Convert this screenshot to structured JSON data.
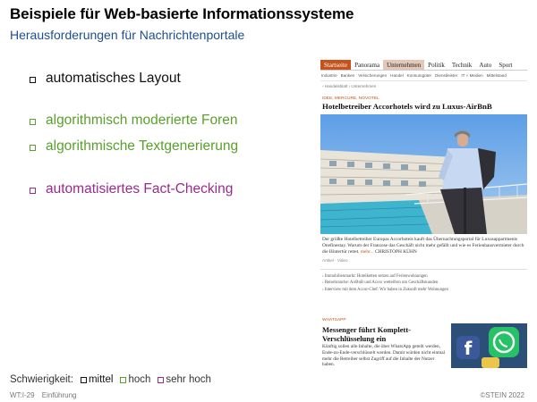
{
  "slide": {
    "title": "Beispiele für Web-basierte Informationssysteme",
    "subtitle": "Herausforderungen für Nachrichtenportale"
  },
  "bullets": [
    {
      "text": "automatisches Layout",
      "color": "#111111"
    },
    {
      "text": "algorithmisch moderierte Foren",
      "color": "#5aa02c"
    },
    {
      "text": "algorithmische Textgenerierung",
      "color": "#5aa02c"
    },
    {
      "text": "automatisiertes Fact-Checking",
      "color": "#9a2a8c"
    }
  ],
  "difficulty": {
    "label": "Schwierigkeit:",
    "options": [
      {
        "text": "mittel",
        "color": "#111111"
      },
      {
        "text": "hoch",
        "color": "#5aa02c"
      },
      {
        "text": "sehr hoch",
        "color": "#9a2a8c"
      }
    ]
  },
  "footer": {
    "slide_number": "WT:I-29",
    "section": "Einführung",
    "copyright": "©STEIN 2022"
  },
  "newspaper": {
    "nav": [
      "Startseite",
      "Panorama",
      "Unternehmen",
      "Politik",
      "Technik",
      "Auto",
      "Sport"
    ],
    "nav_active": "Startseite",
    "nav_selected": "Unternehmen",
    "subnav": [
      "Industrie",
      "Banken",
      "Versicherungen",
      "Handel",
      "Konsumgüter",
      "Dienstleister",
      "IT + Medien",
      "Mittelstand"
    ],
    "breadcrumb": "› Handelsblatt  ›  Unternehmen",
    "kicker": "IDEE, MERCURE, NOVOTEL",
    "headline": "Hotelbetreiber Accorhotels wird zu Luxus-AirBnB",
    "teaser": "Der größte Hotelbetreiber Europas Accorhotels kauft das Übernachtungsportal für Luxusappartments Onefinestay. Warum der Franzose das Geschäft nicht mehr gefällt und wie es Ferienhausvermieter durch die Hintertür rettet.",
    "teaser_more": "mehr...",
    "teaser_author": "CHRISTOPH KÜHN",
    "meta": "Artikel · Video",
    "links": [
      "Immobilienmarkt: Hotelketten setzen auf Ferienwohnungen",
      "Reisebranche: AirBnB und Accor wetteifern um Geschäftskunden",
      "Interview mit dem Accor-Chef: Wir haben in Zukunft mehr Wohnungen"
    ],
    "kicker2": "WHATSAPP",
    "headline2": "Messenger führt Komplett-Verschlüsselung ein",
    "teaser2": "Künftig sollen alle Inhalte, die über WhatsApp geteilt werden, Ende-zu-Ende-verschlüsselt werden. Damit würden nicht einmal mehr die Betreiber selbst Zugriff auf die Inhalte der Nutzer haben."
  }
}
